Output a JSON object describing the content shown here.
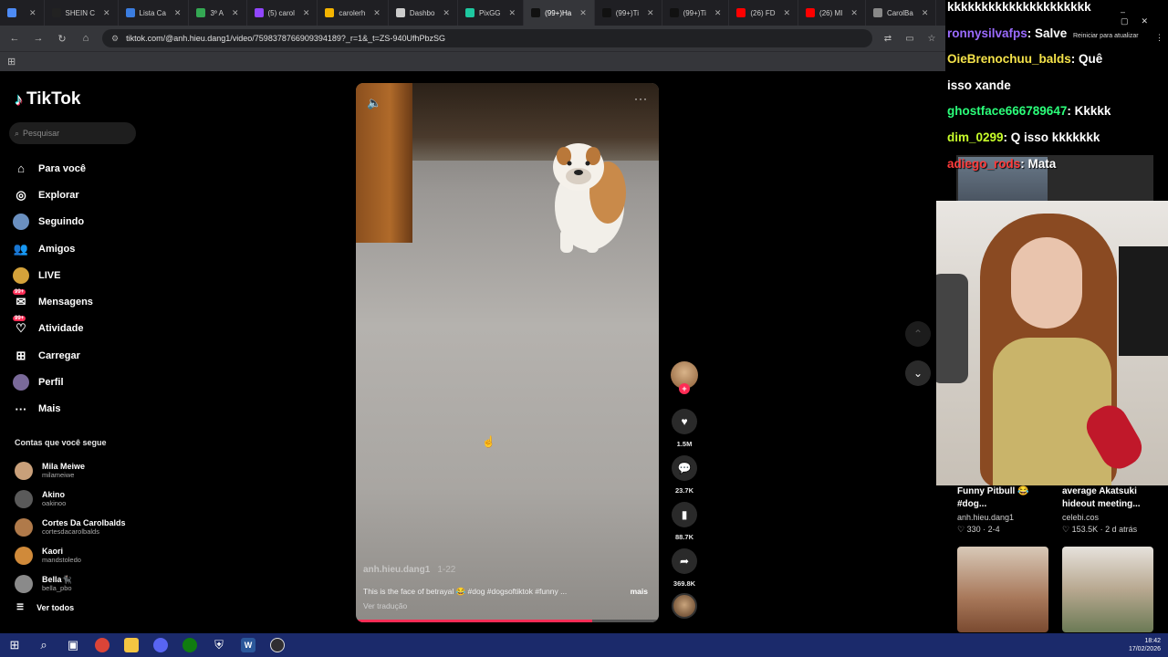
{
  "browser": {
    "tabs": [
      {
        "label": "",
        "color": "#4d8bf5"
      },
      {
        "label": "SHEIN C",
        "color": "#222222"
      },
      {
        "label": "Lista Ca",
        "color": "#3b7de0"
      },
      {
        "label": "3º A",
        "color": "#34a853"
      },
      {
        "label": "(5) carol",
        "color": "#9146ff"
      },
      {
        "label": "carolerh",
        "color": "#f4b400"
      },
      {
        "label": "Dashbo",
        "color": "#cccccc"
      },
      {
        "label": "PixGG",
        "color": "#1ec8a0"
      },
      {
        "label": "(99+)Ha",
        "color": "#111111",
        "active": true
      },
      {
        "label": "(99+)Ti",
        "color": "#111111"
      },
      {
        "label": "(99+)Ti",
        "color": "#111111"
      },
      {
        "label": "(26) FD",
        "color": "#ff0000"
      },
      {
        "label": "(26) MI",
        "color": "#ff0000"
      },
      {
        "label": "CarolBa",
        "color": "#888888"
      }
    ],
    "url": "tiktok.com/@anh.hieu.dang1/video/7598378766909394189?_r=1&_t=ZS-940UfhPbzSG"
  },
  "tiktok": {
    "logo": "TikTok",
    "search_placeholder": "Pesquisar",
    "menu": [
      {
        "label": "Para você",
        "icon": "home-icon",
        "glyph": "⌂"
      },
      {
        "label": "Explorar",
        "icon": "compass-icon",
        "glyph": "◎"
      },
      {
        "label": "Seguindo",
        "icon": "following-avatar",
        "avatar": "#6a8fbf"
      },
      {
        "label": "Amigos",
        "icon": "friends-icon",
        "glyph": "👥"
      },
      {
        "label": "LIVE",
        "icon": "live-avatar",
        "avatar": "#d4a23a"
      },
      {
        "label": "Mensagens",
        "icon": "messages-icon",
        "glyph": "✉",
        "badge": "99+"
      },
      {
        "label": "Atividade",
        "icon": "activity-icon",
        "glyph": "♡",
        "badge": "99+"
      },
      {
        "label": "Carregar",
        "icon": "upload-icon",
        "glyph": "⊞"
      },
      {
        "label": "Perfil",
        "icon": "profile-avatar",
        "avatar": "#7a6a9a"
      },
      {
        "label": "Mais",
        "icon": "more-icon",
        "glyph": "···"
      }
    ],
    "following_title": "Contas que você segue",
    "following": [
      {
        "name": "Mila Meiwe",
        "handle": "milameiwe",
        "color": "#c9a07a"
      },
      {
        "name": "Akino",
        "handle": "oakinoo",
        "color": "#5a5a5a"
      },
      {
        "name": "Cortes Da Carolbalds",
        "handle": "cortesdacarolbalds",
        "color": "#b07a4a"
      },
      {
        "name": "Kaori",
        "handle": "mandstoledo",
        "color": "#d08a3a"
      },
      {
        "name": "Bella🐈‍⬛",
        "handle": "bella_pbo",
        "color": "#8a8a8a"
      }
    ],
    "see_all": "Ver todos"
  },
  "video": {
    "author": "anh.hieu.dang1",
    "date": "1-22",
    "caption": "This is the face of betrayal 😂 #dog #dogsoftiktok #funny ...",
    "more": "mais",
    "translate": "Ver tradução",
    "progress": 0.78,
    "likes": "1.5M",
    "comments": "23.7K",
    "saves": "88.7K",
    "shares": "369.8K"
  },
  "stream": {
    "chat": [
      {
        "user": "kkkkkkkkkkkkkkkkkkkkk",
        "msg": "",
        "cls": ""
      },
      {
        "user": "ronnysilvafps",
        "msg": ": Salve",
        "cls": "u1"
      },
      {
        "user": "OieBrenochuu_balds",
        "msg": ": Quê",
        "cls": "u2"
      },
      {
        "user": "",
        "msg": "isso xande",
        "cls": ""
      },
      {
        "user": "ghostface666789647",
        "msg": ": Kkkkk",
        "cls": "u3"
      },
      {
        "user": "dim_0299",
        "msg": ": Q isso kkkkkkk",
        "cls": "u4"
      },
      {
        "user": "adiego_rods",
        "msg": ": Mata",
        "cls": "u5"
      }
    ],
    "reload_label": "Reiniciar para atualizar"
  },
  "recommended": [
    {
      "title": "Funny Pitbull 😂 #dog...",
      "author": "anh.hieu.dang1",
      "meta": "♡ 330 · 2-4"
    },
    {
      "title": "average Akatsuki hideout meeting...",
      "author": "celebi.cos",
      "meta": "♡ 153.5K · 2 d atrás"
    }
  ],
  "taskbar": {
    "time": "18:42",
    "date": "17/02/2026"
  }
}
